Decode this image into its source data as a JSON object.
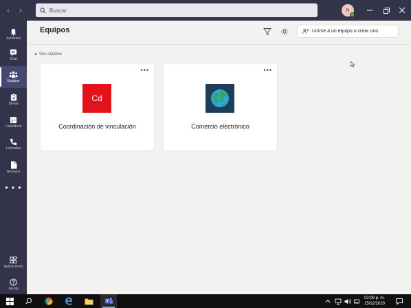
{
  "titlebar": {
    "back_glyph": "‹",
    "forward_glyph": "›",
    "search_placeholder": "Buscar",
    "avatar_initial": "N"
  },
  "rail": {
    "items": [
      {
        "label": "Actividad",
        "icon": "bell-icon"
      },
      {
        "label": "Chat",
        "icon": "chat-icon"
      },
      {
        "label": "Equipos",
        "icon": "teams-icon",
        "active": true
      },
      {
        "label": "Tareas",
        "icon": "tasks-icon"
      },
      {
        "label": "Calendario",
        "icon": "calendar-icon"
      },
      {
        "label": "Llamadas",
        "icon": "phone-icon"
      },
      {
        "label": "Archivos",
        "icon": "files-icon"
      }
    ],
    "more": "• • •",
    "apps_label": "Aplicaciones",
    "help_label": "Ayuda"
  },
  "header": {
    "title": "Equipos",
    "join_label": "Unirse a un equipo o crear uno"
  },
  "section": {
    "label": "Sus equipos"
  },
  "teams": [
    {
      "name": "Coordinación de vinculación",
      "tile_text": "Cd",
      "tile_color": "#e3121b"
    },
    {
      "name": "Comercio electrónico",
      "tile_text": "",
      "tile_color": "#1e3d59",
      "tile_icon": "globe-icon"
    }
  ],
  "card_more": "•••",
  "taskbar": {
    "time": "02:09 p. m.",
    "date": "15/12/2020"
  },
  "colors": {
    "rail_bg": "#33344a",
    "rail_active": "#464775",
    "presence": "#6bb700"
  }
}
